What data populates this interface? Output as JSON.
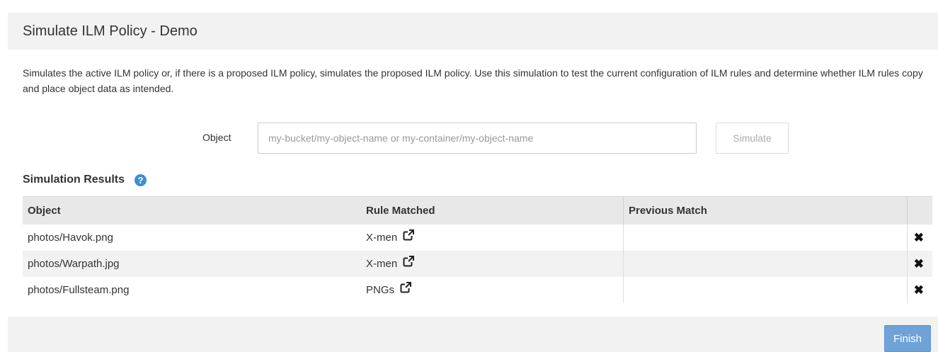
{
  "header": {
    "title": "Simulate ILM Policy - Demo"
  },
  "description": "Simulates the active ILM policy or, if there is a proposed ILM policy, simulates the proposed ILM policy. Use this simulation to test the current configuration of ILM rules and determine whether ILM rules copy and place object data as intended.",
  "form": {
    "object_label": "Object",
    "object_value": "",
    "object_placeholder": "my-bucket/my-object-name or my-container/my-object-name",
    "simulate_label": "Simulate"
  },
  "results": {
    "title": "Simulation Results",
    "help_icon": "question-circle-icon",
    "columns": [
      "Object",
      "Rule Matched",
      "Previous Match",
      ""
    ],
    "rows": [
      {
        "object": "photos/Havok.png",
        "rule": "X-men",
        "previous": ""
      },
      {
        "object": "photos/Warpath.jpg",
        "rule": "X-men",
        "previous": ""
      },
      {
        "object": "photos/Fullsteam.png",
        "rule": "PNGs",
        "previous": ""
      }
    ],
    "rule_icon": "external-link-icon",
    "remove_icon": "close-icon"
  },
  "footer": {
    "finish_label": "Finish"
  },
  "colors": {
    "header_bg": "#f2f2f2",
    "help_icon": "#3a8fd4",
    "finish_button": "#6fa3d8"
  }
}
